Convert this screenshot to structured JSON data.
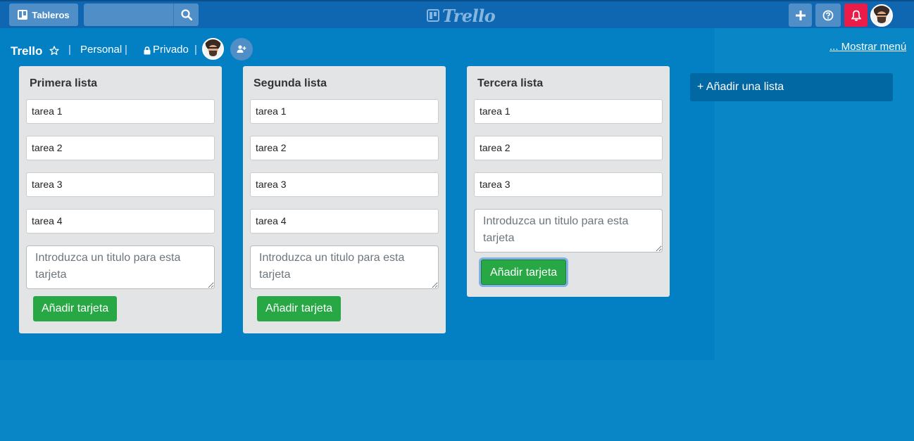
{
  "topbar": {
    "boards_label": "Tableros",
    "search_placeholder": "",
    "logo_text": "Trello",
    "colors": {
      "bar": "#0e67b0",
      "button": "#4f8ec7",
      "notification": "#eb1c47"
    }
  },
  "board": {
    "title": "Trello",
    "separator": "|",
    "team": "Personal",
    "privacy": "Privado",
    "show_menu": "... Mostrar menú"
  },
  "lists": [
    {
      "title": "Primera lista",
      "cards": [
        "tarea 1",
        "tarea 2",
        "tarea 3",
        "tarea 4"
      ],
      "input_placeholder": "Introduzca un titulo para esta tarjeta",
      "add_button": "Añadir tarjeta"
    },
    {
      "title": "Segunda lista",
      "cards": [
        "tarea 1",
        "tarea 2",
        "tarea 3",
        "tarea 4"
      ],
      "input_placeholder": "Introduzca un titulo para esta tarjeta",
      "add_button": "Añadir tarjeta"
    },
    {
      "title": "Tercera lista",
      "cards": [
        "tarea 1",
        "tarea 2",
        "tarea 3"
      ],
      "input_placeholder": "Introduzca un titulo para esta tarjeta",
      "add_button": "Añadir tarjeta"
    }
  ],
  "add_list_label": "+ Añadir una lista",
  "icons": [
    "boards-icon",
    "search-icon",
    "plus-icon",
    "help-icon",
    "bell-icon",
    "star-icon",
    "lock-icon",
    "add-member-icon"
  ]
}
